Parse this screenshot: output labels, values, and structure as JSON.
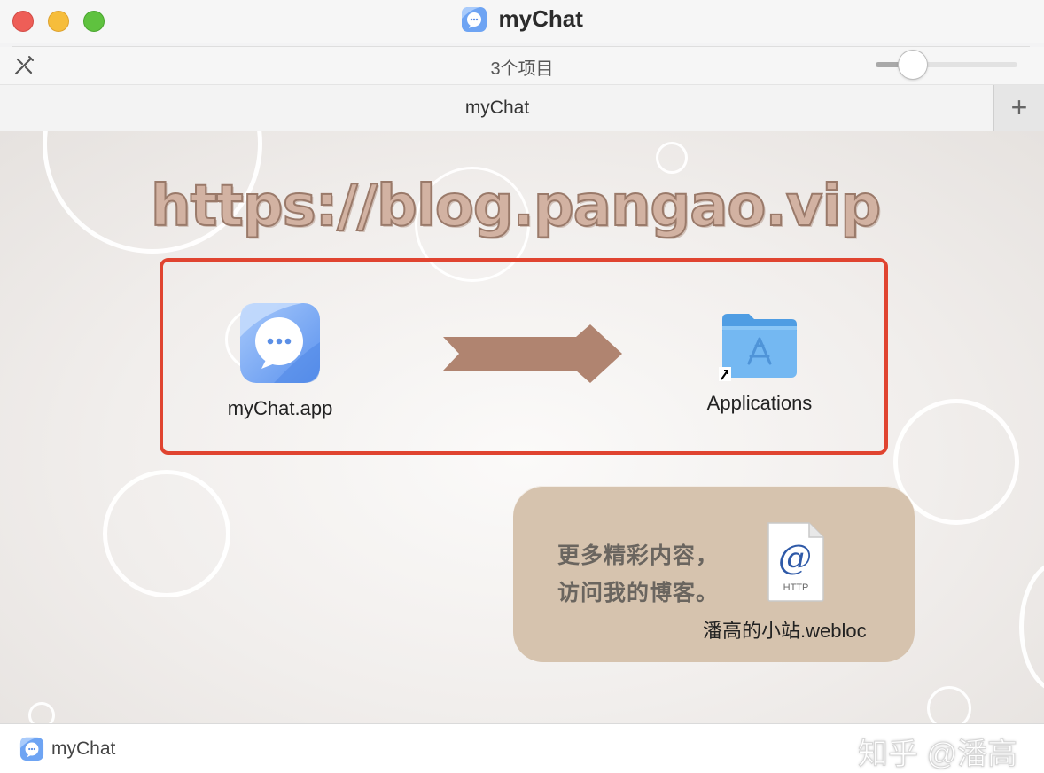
{
  "window": {
    "title": "myChat",
    "traffic_lights": {
      "close_color": "#ee5e57",
      "minimize_color": "#f6bd3b",
      "zoom_color": "#5fc23f"
    },
    "title_icon": "mychat-app-icon"
  },
  "toolbar": {
    "tool_icon": "wand-icon",
    "item_count": "3个项目",
    "icon_size_slider": {
      "value_fraction": 0.2
    }
  },
  "tabs": {
    "items": [
      {
        "label": "myChat",
        "selected": true
      }
    ],
    "add_label": "+"
  },
  "content": {
    "watermark_text": "https://blog.pangao.vip",
    "drag_box_color": "#e04430",
    "items": {
      "app": {
        "label": "myChat.app",
        "icon": "mychat-app-icon"
      },
      "arrow": {
        "icon": "arrow-right-icon",
        "color": "#b08470"
      },
      "applications": {
        "label": "Applications",
        "icon": "applications-folder-alias-icon"
      }
    },
    "promo": {
      "line1": "更多精彩内容，",
      "line2": "访问我的博客。",
      "file_label": "潘高的小站.webloc",
      "file_icon": "webloc-http-icon",
      "file_icon_symbol": "@",
      "file_icon_caption": "HTTP",
      "background": "#d6c3ae"
    }
  },
  "statusbar": {
    "icon": "mychat-app-icon",
    "label": "myChat",
    "watermark": "知乎 @潘高"
  }
}
